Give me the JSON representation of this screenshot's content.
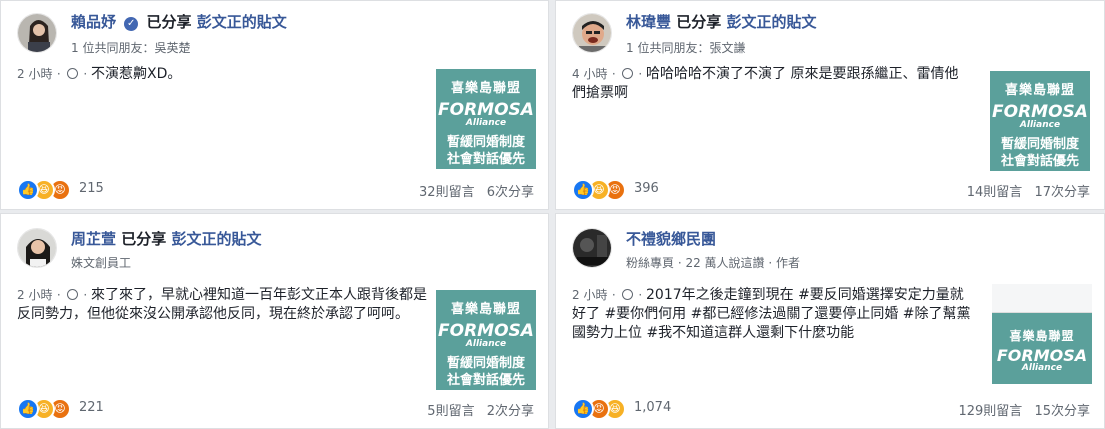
{
  "shared_label": "已分享",
  "posts": [
    {
      "author": "賴品妤",
      "shared_post": "彭文正的貼文",
      "subtitle": "1 位共同朋友：吳英楚",
      "time": "2 小時",
      "text": "不演惹齁XD。",
      "reactions": "215",
      "comments": "32則留言",
      "shares": "6次分享"
    },
    {
      "author": "林瑋豐",
      "shared_post": "彭文正的貼文",
      "subtitle": "1 位共同朋友：張文謙",
      "time": "4 小時",
      "text": "哈哈哈哈不演了不演了 原來是要跟孫繼正、雷倩他們搶票啊",
      "reactions": "396",
      "comments": "14則留言",
      "shares": "17次分享"
    },
    {
      "author": "周芷萱",
      "shared_post": "彭文正的貼文",
      "subtitle": "姝文創員工",
      "time": "2 小時",
      "text": "來了來了，早就心裡知道一百年彭文正本人跟背後都是反同勢力，但他從來沒公開承認他反同，現在終於承認了呵呵。",
      "reactions": "221",
      "comments": "5則留言",
      "shares": "2次分享"
    },
    {
      "author": "不禮貌鄉民團",
      "subtitle": "粉絲專頁 · 22 萬人說這讚 · 作者",
      "time": "2 小時",
      "text": "2017年之後走鐘到現在 #要反同婚選擇安定力量就好了 #要你們何用 #都已經修法過關了還要停止同婚 #除了幫黨國勢力上位 #我不知道這群人還剩下什麼功能",
      "reactions": "1,074",
      "comments": "129則留言",
      "shares": "15次分享"
    }
  ],
  "thumbnail": {
    "title": "喜樂島聯盟",
    "logo": "FORMOSA",
    "logo_sub": "Alliance",
    "line1": "暫緩同婚制度",
    "line2": "社會對話優先",
    "bg_color": "#5ba09b"
  },
  "colors": {
    "link": "#385898",
    "meta": "#606770",
    "like": "#1877f2",
    "haha": "#f7b125",
    "angry": "#e9710f"
  }
}
